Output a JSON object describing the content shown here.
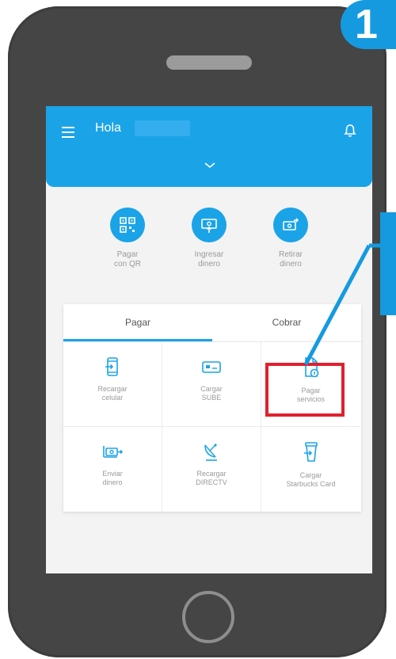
{
  "step_number": "1",
  "header": {
    "greeting": "Hola"
  },
  "quick_actions": [
    {
      "label": "Pagar\ncon QR",
      "icon": "qr-code-icon"
    },
    {
      "label": "Ingresar\ndinero",
      "icon": "deposit-money-icon"
    },
    {
      "label": "Retirar\ndinero",
      "icon": "withdraw-money-icon"
    }
  ],
  "tabs": [
    {
      "label": "Pagar",
      "active": true
    },
    {
      "label": "Cobrar",
      "active": false
    }
  ],
  "grid": [
    {
      "label": "Recargar\ncelular",
      "icon": "phone-topup-icon"
    },
    {
      "label": "Cargar\nSUBE",
      "icon": "sube-card-icon"
    },
    {
      "label": "Pagar\nservicios",
      "icon": "bill-document-icon"
    },
    {
      "label": "Enviar\ndinero",
      "icon": "send-money-icon"
    },
    {
      "label": "Recargar\nDIRECTV",
      "icon": "satellite-dish-icon"
    },
    {
      "label": "Cargar\nStarbucks Card",
      "icon": "coffee-cup-icon"
    }
  ],
  "colors": {
    "primary": "#1ba3e8",
    "callout": "#159ae0",
    "highlight": "#e0202e",
    "phone_body": "#454545"
  }
}
